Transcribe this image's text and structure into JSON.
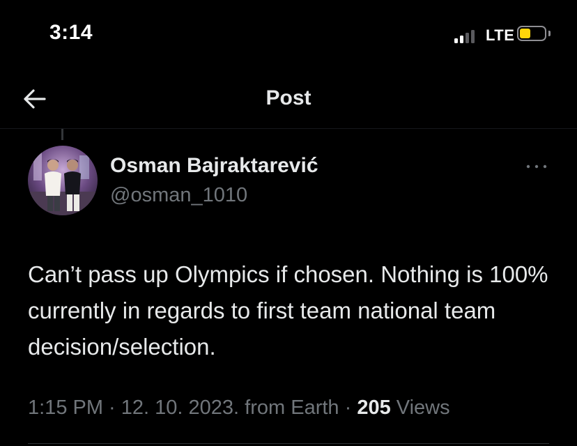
{
  "status_bar": {
    "time": "3:14",
    "network": "LTE",
    "signal_bars_active": 2,
    "signal_bars_total": 4,
    "battery_level": 0.45,
    "battery_color": "#ffd60a"
  },
  "nav": {
    "title": "Post",
    "back_icon": "arrow-left-icon"
  },
  "post": {
    "author_name": "Osman Bajraktarević",
    "author_handle": "@osman_1010",
    "more_icon": "more-horizontal-icon",
    "text": "Can’t pass up Olympics if chosen. Nothing is 100% currently in regards to first team national team decision/selection.",
    "meta": {
      "time": "1:15 PM",
      "separator": " · ",
      "date": "12. 10. 2023.",
      "source": "from Earth",
      "views_count": "205",
      "views_label": "Views"
    }
  },
  "colors": {
    "background": "#000000",
    "primary_text": "#e7e9ea",
    "secondary_text": "#71767b"
  }
}
